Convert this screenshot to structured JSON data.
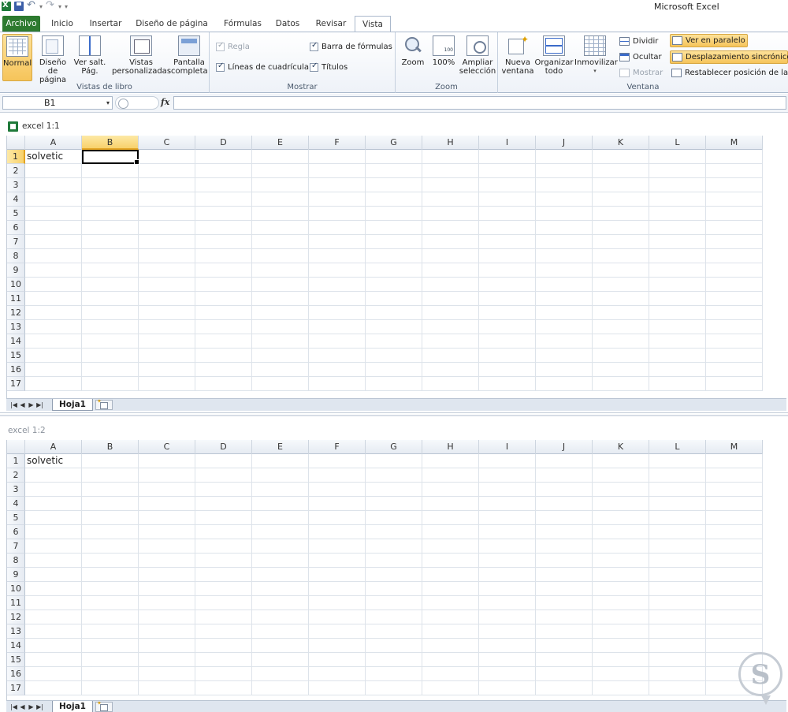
{
  "app": {
    "title": "Microsoft Excel"
  },
  "tabs": [
    {
      "label": "Archivo"
    },
    {
      "label": "Inicio"
    },
    {
      "label": "Insertar"
    },
    {
      "label": "Diseño de página"
    },
    {
      "label": "Fórmulas"
    },
    {
      "label": "Datos"
    },
    {
      "label": "Revisar"
    },
    {
      "label": "Vista"
    }
  ],
  "ribbon": {
    "vistas_libro": {
      "label": "Vistas de libro",
      "normal": "Normal",
      "diseno_line1": "Diseño",
      "diseno_line2": "de página",
      "saltpag_line1": "Ver salt.",
      "saltpag_line2": "Pág.",
      "vistas_line1": "Vistas",
      "vistas_line2": "personalizadas",
      "pantalla_line1": "Pantalla",
      "pantalla_line2": "completa"
    },
    "mostrar": {
      "label": "Mostrar",
      "regla": "Regla",
      "lineas": "Líneas de cuadrícula",
      "barra": "Barra de fórmulas",
      "titulos": "Títulos"
    },
    "zoom": {
      "label": "Zoom",
      "zoom": "Zoom",
      "cien": "100%",
      "ampliar_line1": "Ampliar",
      "ampliar_line2": "selección"
    },
    "ventana": {
      "label": "Ventana",
      "nueva_line1": "Nueva",
      "nueva_line2": "ventana",
      "organizar_line1": "Organizar",
      "organizar_line2": "todo",
      "inmovilizar": "Inmovilizar",
      "dividir": "Dividir",
      "ocultar": "Ocultar",
      "mostrar": "Mostrar",
      "paralelo": "Ver en paralelo",
      "sincronico": "Desplazamiento sincrónico",
      "restablecer": "Restablecer posición de la v"
    }
  },
  "formula_bar": {
    "namebox": "B1",
    "fx": "fx",
    "value": ""
  },
  "columns": [
    "A",
    "B",
    "C",
    "D",
    "E",
    "F",
    "G",
    "H",
    "I",
    "J",
    "K",
    "L",
    "M"
  ],
  "window1": {
    "title": "excel 1:1",
    "active_cell": "B1",
    "sheet_tab": "Hoja1",
    "rows": [
      [
        "solvetic"
      ],
      [],
      [],
      [],
      [],
      [],
      [],
      [],
      [],
      [],
      [],
      [],
      [],
      [],
      [],
      [],
      []
    ]
  },
  "window2": {
    "title": "excel 1:2",
    "sheet_tab": "Hoja1",
    "rows": [
      [
        "solvetic"
      ],
      [],
      [],
      [],
      [],
      [],
      [],
      [],
      [],
      [],
      [],
      [],
      [],
      [],
      [],
      [],
      []
    ]
  },
  "colors": {
    "file_tab": "#2d7a2f",
    "selection": "#f8d16b",
    "accent": "#3b6bc9"
  }
}
